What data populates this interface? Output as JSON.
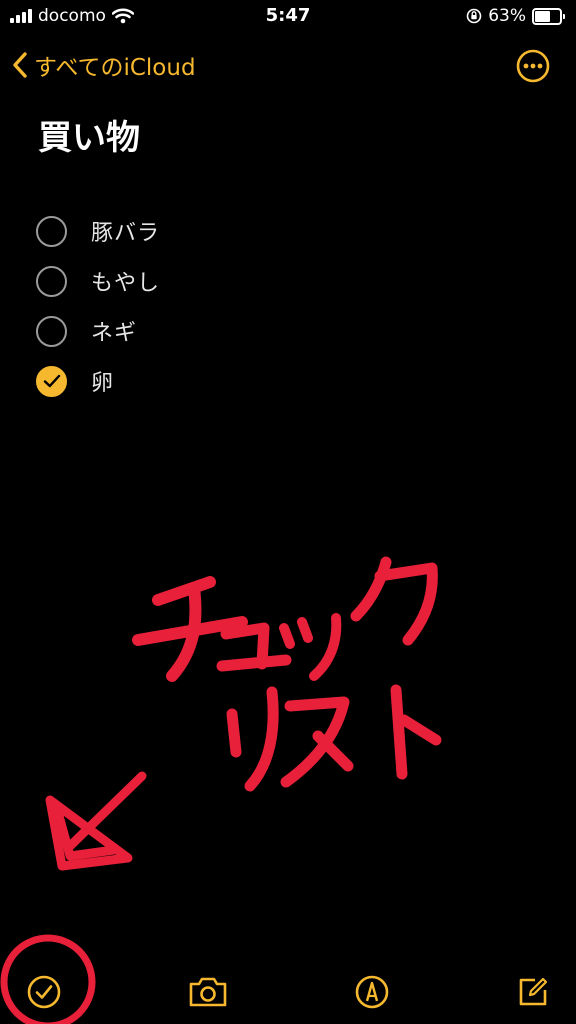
{
  "status_bar": {
    "carrier": "docomo",
    "time": "5:47",
    "battery_percent": "63%",
    "battery_level": 0.63,
    "icons": [
      "signal-icon",
      "wifi-icon",
      "orientation-lock-icon",
      "battery-icon"
    ]
  },
  "nav": {
    "back_label": "すべてのiCloud",
    "back_icon": "chevron-left-icon",
    "more_icon": "ellipsis-circle-icon"
  },
  "note": {
    "title": "買い物",
    "checklist": [
      {
        "text": "豚バラ",
        "checked": false
      },
      {
        "text": "もやし",
        "checked": false
      },
      {
        "text": "ネギ",
        "checked": false
      },
      {
        "text": "卵",
        "checked": true
      }
    ]
  },
  "annotation": {
    "text_line1": "チェック",
    "text_line2": "リスト",
    "color": "#e8203a"
  },
  "toolbar": {
    "items": [
      "checklist-icon",
      "camera-icon",
      "markup-pen-icon",
      "compose-icon"
    ]
  },
  "colors": {
    "accent": "#f5b82e",
    "background": "#000000",
    "annotation": "#e8203a"
  }
}
